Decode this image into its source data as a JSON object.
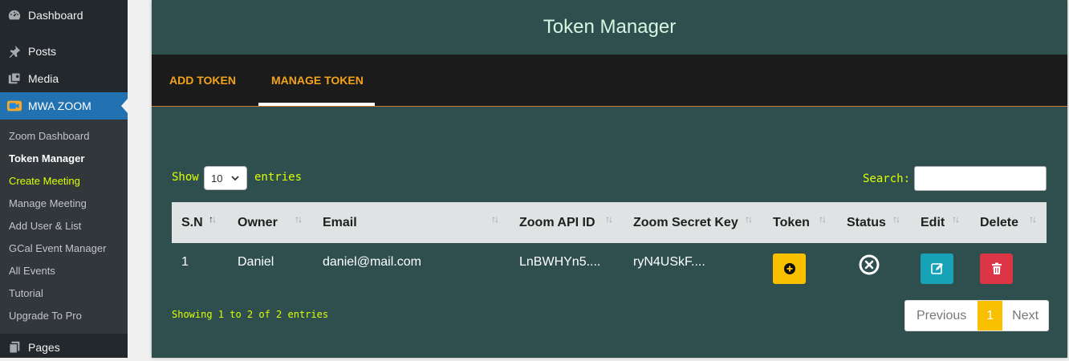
{
  "sidebar": {
    "items": [
      {
        "label": "Dashboard",
        "icon": "dashboard-icon"
      },
      {
        "label": "Posts",
        "icon": "pin-icon"
      },
      {
        "label": "Media",
        "icon": "media-icon"
      },
      {
        "label": "MWA ZOOM",
        "icon": "zoom-camera-icon"
      },
      {
        "label": "Pages",
        "icon": "pages-icon"
      }
    ],
    "submenu": [
      "Zoom Dashboard",
      "Token Manager",
      "Create Meeting",
      "Manage Meeting",
      "Add User & List",
      "GCal Event Manager",
      "All Events",
      "Tutorial",
      "Upgrade To Pro"
    ]
  },
  "panel": {
    "title": "Token Manager",
    "tabs": [
      "ADD TOKEN",
      "MANAGE TOKEN"
    ],
    "active_tab": "MANAGE TOKEN"
  },
  "table": {
    "show_label": "Show",
    "entries_label": "entries",
    "page_length": "10",
    "search_label": "Search:",
    "columns": [
      "S.N",
      "Owner",
      "Email",
      "Zoom API ID",
      "Zoom Secret Key",
      "Token",
      "Status",
      "Edit",
      "Delete"
    ],
    "rows": [
      {
        "sn": "1",
        "owner": "Daniel",
        "email": "daniel@mail.com",
        "api_id": "LnBWHYn5....",
        "secret_key": "ryN4USkF...."
      }
    ],
    "info": "Showing 1 to 2 of 2 entries",
    "pagination": {
      "previous": "Previous",
      "current": "1",
      "next": "Next"
    }
  },
  "colors": {
    "panel_bg": "#2f4f4f",
    "tab_text": "#f3a31a",
    "accent_yellow": "#f9c000",
    "label_yellow": "#ddff00",
    "edit_blue": "#17a2b8",
    "delete_red": "#dc3545",
    "wp_active": "#2271b1"
  }
}
